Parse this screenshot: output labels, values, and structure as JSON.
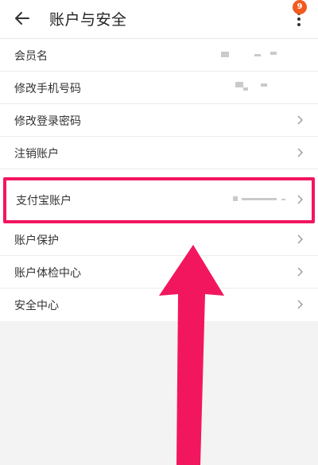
{
  "header": {
    "title": "账户与安全",
    "badge_count": "9"
  },
  "rows": [
    {
      "label": "会员名",
      "has_chevron": false
    },
    {
      "label": "修改手机号码",
      "has_chevron": false
    },
    {
      "label": "修改登录密码",
      "has_chevron": true
    },
    {
      "label": "注销账户",
      "has_chevron": true
    },
    {
      "label": "支付宝账户",
      "has_chevron": true,
      "highlighted": true
    },
    {
      "label": "账户保护",
      "has_chevron": true
    },
    {
      "label": "账户体检中心",
      "has_chevron": true
    },
    {
      "label": "安全中心",
      "has_chevron": true
    }
  ],
  "colors": {
    "highlight": "#f2165f",
    "badge": "#f25a1f"
  }
}
